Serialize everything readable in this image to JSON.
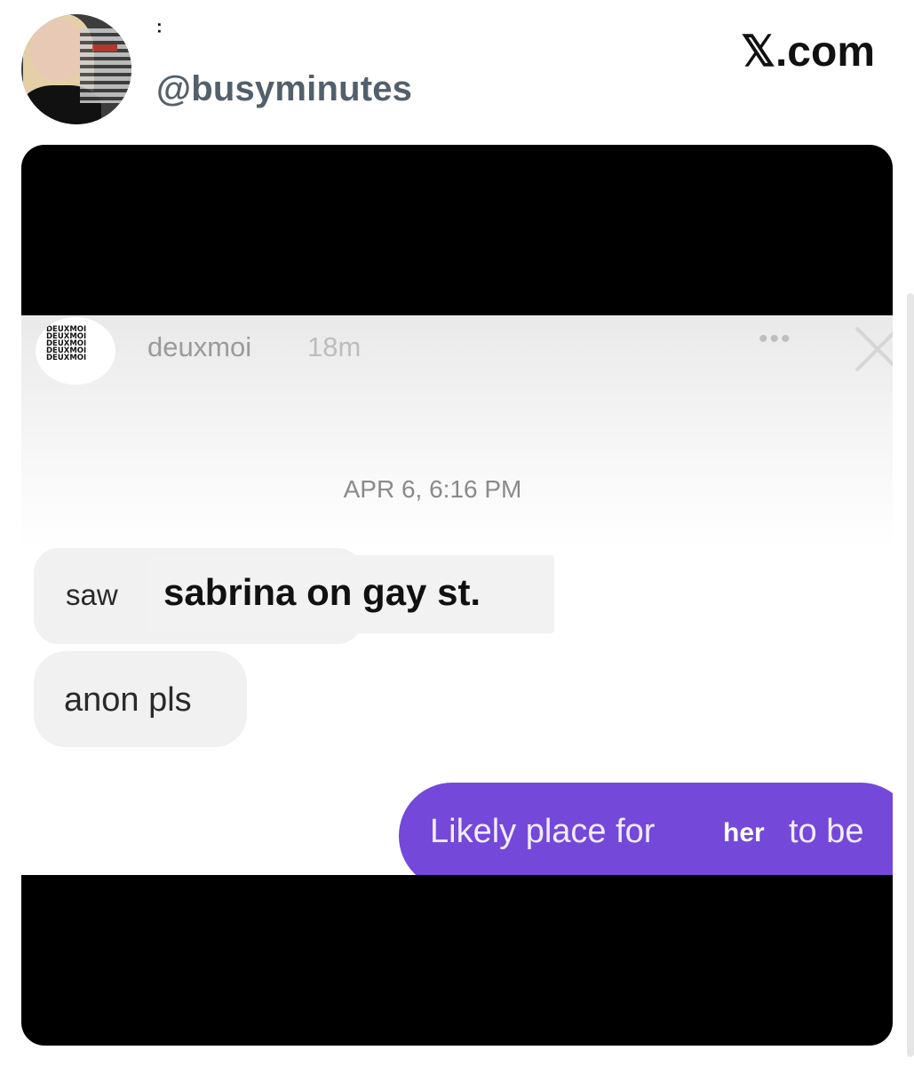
{
  "tweet": {
    "display_name": "˸",
    "handle": "@busyminutes",
    "site_label": "𝕏.com"
  },
  "story": {
    "username": "deuxmoi",
    "time_ago": "18m",
    "more_icon": "more-dots-icon",
    "close_icon": "close-icon",
    "avatar_text": "DEUXMOI\nDEUXMOI\nDEUXMOI\nDEUXMOI\nDEUXMOI",
    "timestamp": "APR 6, 6:16 PM",
    "messages": [
      {
        "prefix": "saw",
        "edited_text": "sabrina on gay st."
      },
      {
        "text": "anon pls"
      }
    ],
    "reply": {
      "prefix": "Likely place for",
      "edited_word": "her",
      "suffix": "to be"
    },
    "colors": {
      "reply_bubble": "#7448d9",
      "incoming_bubble": "#f1f1f1",
      "media_background": "#000000"
    }
  }
}
